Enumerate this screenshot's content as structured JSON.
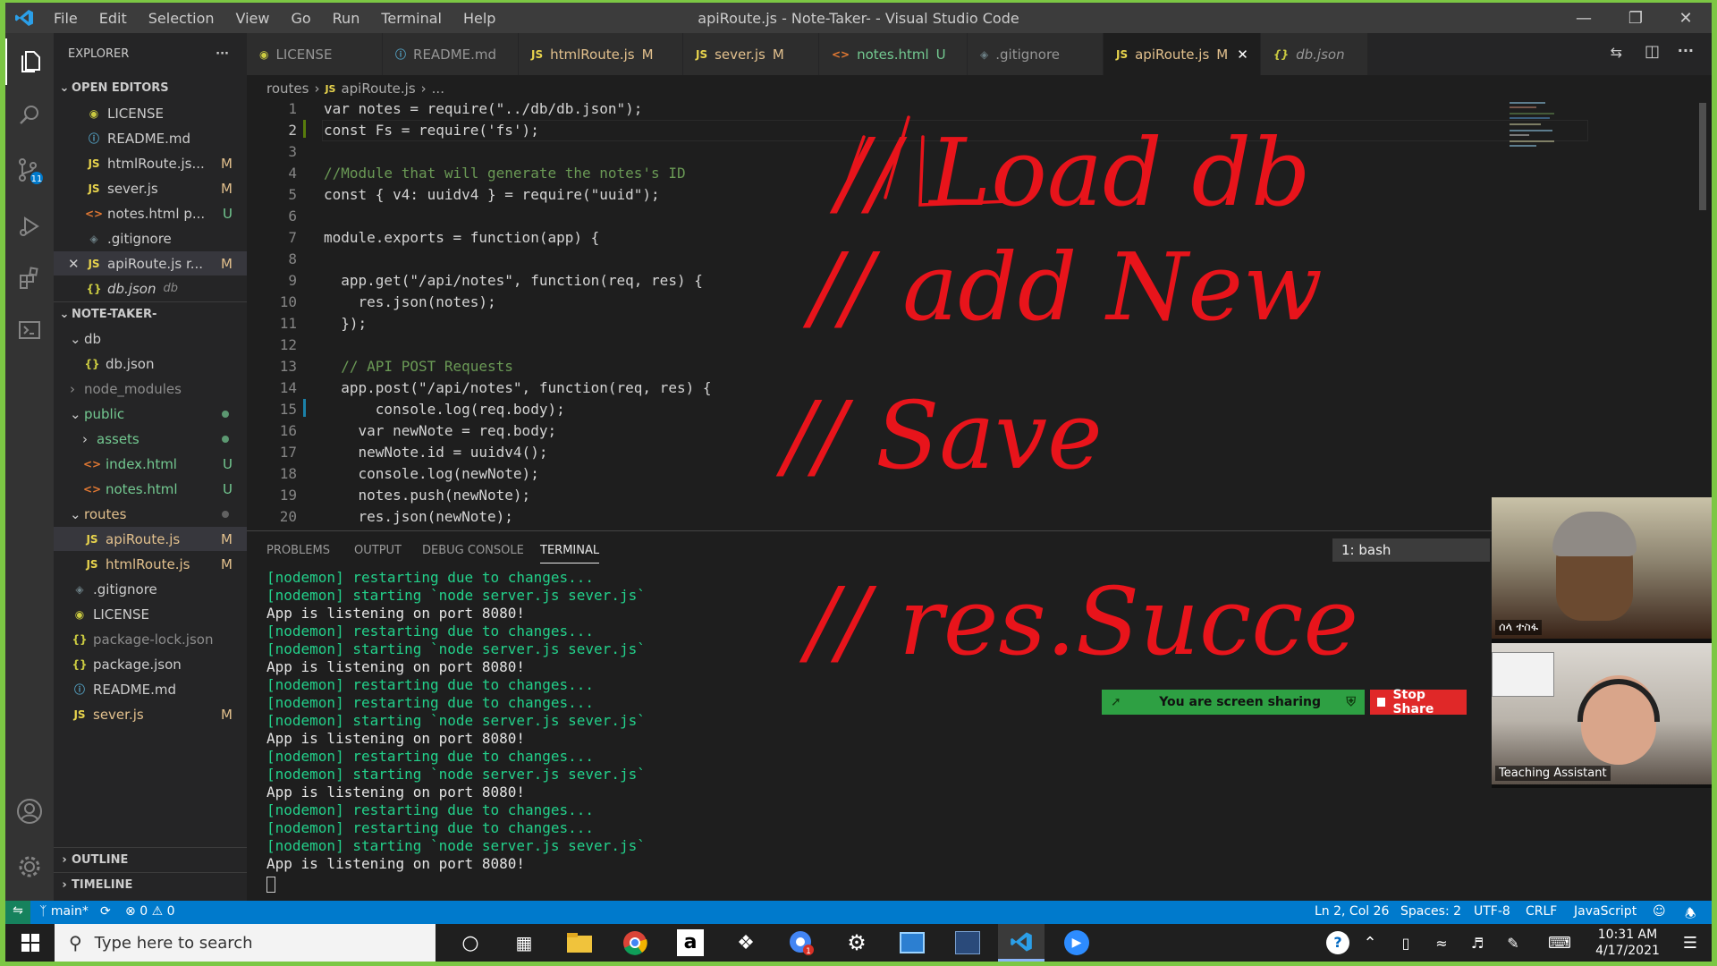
{
  "window": {
    "title": "apiRoute.js - Note-Taker- - Visual Studio Code",
    "menu": [
      "File",
      "Edit",
      "Selection",
      "View",
      "Go",
      "Run",
      "Terminal",
      "Help"
    ]
  },
  "sidebar": {
    "title": "EXPLORER",
    "open_editors_label": "OPEN EDITORS",
    "open_editors": [
      {
        "name": "LICENSE",
        "icon": "license-icon",
        "badge": ""
      },
      {
        "name": "README.md",
        "icon": "info-icon",
        "badge": ""
      },
      {
        "name": "htmlRoute.js...",
        "icon": "js-icon",
        "badge": "M"
      },
      {
        "name": "sever.js",
        "icon": "js-icon",
        "badge": "M"
      },
      {
        "name": "notes.html  p...",
        "icon": "html-icon",
        "badge": "U"
      },
      {
        "name": ".gitignore",
        "icon": "git-icon",
        "badge": ""
      },
      {
        "name": "apiRoute.js  r...",
        "icon": "js-icon",
        "badge": "M"
      },
      {
        "name": "db.json",
        "icon": "json-icon",
        "badge": "",
        "hint": "db"
      }
    ],
    "project_label": "NOTE-TAKER-",
    "tree": [
      {
        "name": "db",
        "type": "folder-open"
      },
      {
        "name": "db.json",
        "type": "json"
      },
      {
        "name": "node_modules",
        "type": "folder-closed"
      },
      {
        "name": "public",
        "type": "folder-open"
      },
      {
        "name": "assets",
        "type": "folder-closed"
      },
      {
        "name": "index.html",
        "type": "html",
        "badge": "U"
      },
      {
        "name": "notes.html",
        "type": "html",
        "badge": "U"
      },
      {
        "name": "routes",
        "type": "folder-open"
      },
      {
        "name": "apiRoute.js",
        "type": "js",
        "badge": "M"
      },
      {
        "name": "htmlRoute.js",
        "type": "js",
        "badge": "M"
      },
      {
        "name": ".gitignore",
        "type": "git"
      },
      {
        "name": "LICENSE",
        "type": "license"
      },
      {
        "name": "package-lock.json",
        "type": "json"
      },
      {
        "name": "package.json",
        "type": "json"
      },
      {
        "name": "README.md",
        "type": "md"
      },
      {
        "name": "sever.js",
        "type": "js",
        "badge": "M"
      }
    ],
    "outline_label": "OUTLINE",
    "timeline_label": "TIMELINE"
  },
  "tabs": [
    {
      "label": "LICENSE",
      "badge": ""
    },
    {
      "label": "README.md",
      "badge": ""
    },
    {
      "label": "htmlRoute.js",
      "badge": "M"
    },
    {
      "label": "sever.js",
      "badge": "M"
    },
    {
      "label": "notes.html",
      "badge": "U"
    },
    {
      "label": ".gitignore",
      "badge": ""
    },
    {
      "label": "apiRoute.js",
      "badge": "M"
    },
    {
      "label": "db.json",
      "badge": ""
    }
  ],
  "breadcrumb": {
    "folder": "routes",
    "file": "apiRoute.js",
    "more": "..."
  },
  "editor": {
    "line_numbers": [
      "1",
      "2",
      "3",
      "4",
      "5",
      "6",
      "7",
      "8",
      "9",
      "10",
      "11",
      "12",
      "13",
      "14",
      "15",
      "16",
      "17",
      "18",
      "19",
      "20"
    ],
    "code_lines": [
      "var notes = require(\"../db/db.json\");",
      "const Fs = require('fs');",
      "",
      "//Module that will generate the notes's ID",
      "const { v4: uuidv4 } = require(\"uuid\");",
      "",
      "module.exports = function(app) {",
      "",
      "  app.get(\"/api/notes\", function(req, res) {",
      "    res.json(notes);",
      "  });",
      "",
      "  // API POST Requests",
      "  app.post(\"/api/notes\", function(req, res) {",
      "      console.log(req.body);",
      "    var newNote = req.body;",
      "    newNote.id = uuidv4();",
      "    console.log(newNote);",
      "    notes.push(newNote);",
      "    res.json(newNote);"
    ]
  },
  "annotations": [
    "// Load db",
    "// add New",
    "// Save",
    "// res.Succe"
  ],
  "panel": {
    "tabs": [
      "PROBLEMS",
      "OUTPUT",
      "DEBUG CONSOLE",
      "TERMINAL"
    ],
    "active_tab": "TERMINAL",
    "terminal_select": "1: bash",
    "terminal_lines": [
      {
        "text": "[nodemon] restarting due to changes...",
        "color": "green"
      },
      {
        "text": "[nodemon] starting `node server.js sever.js`",
        "color": "green"
      },
      {
        "text": "App is listening on port 8080!",
        "color": "white"
      },
      {
        "text": "[nodemon] restarting due to changes...",
        "color": "green"
      },
      {
        "text": "[nodemon] starting `node server.js sever.js`",
        "color": "green"
      },
      {
        "text": "App is listening on port 8080!",
        "color": "white"
      },
      {
        "text": "[nodemon] restarting due to changes...",
        "color": "green"
      },
      {
        "text": "[nodemon] restarting due to changes...",
        "color": "green"
      },
      {
        "text": "[nodemon] starting `node server.js sever.js`",
        "color": "green"
      },
      {
        "text": "App is listening on port 8080!",
        "color": "white"
      },
      {
        "text": "[nodemon] restarting due to changes...",
        "color": "green"
      },
      {
        "text": "[nodemon] starting `node server.js sever.js`",
        "color": "green"
      },
      {
        "text": "App is listening on port 8080!",
        "color": "white"
      },
      {
        "text": "[nodemon] restarting due to changes...",
        "color": "green"
      },
      {
        "text": "[nodemon] restarting due to changes...",
        "color": "green"
      },
      {
        "text": "[nodemon] starting `node server.js sever.js`",
        "color": "green"
      },
      {
        "text": "App is listening on port 8080!",
        "color": "white"
      }
    ]
  },
  "statusbar": {
    "branch": "main*",
    "errors": "0",
    "warnings": "0",
    "position": "Ln 2, Col 26",
    "spaces": "Spaces: 2",
    "encoding": "UTF-8",
    "eol": "CRLF",
    "language": "JavaScript"
  },
  "screen_share": {
    "message": "You are screen sharing",
    "stop_label": "Stop Share"
  },
  "video": [
    {
      "name": "ሰላ ተስፋ"
    },
    {
      "name": "Teaching Assistant"
    }
  ],
  "taskbar": {
    "search_placeholder": "Type here to search",
    "time": "10:31 AM",
    "date": "4/17/2021"
  },
  "colors": {
    "accent": "#007acc",
    "activity_bar": "#333333",
    "sidebar": "#252526",
    "editor": "#1e1e1e",
    "annotation_ink": "#e8141b",
    "share_bar": "#2ea043",
    "stop_share": "#e02828",
    "outer_border": "#7cc744"
  }
}
